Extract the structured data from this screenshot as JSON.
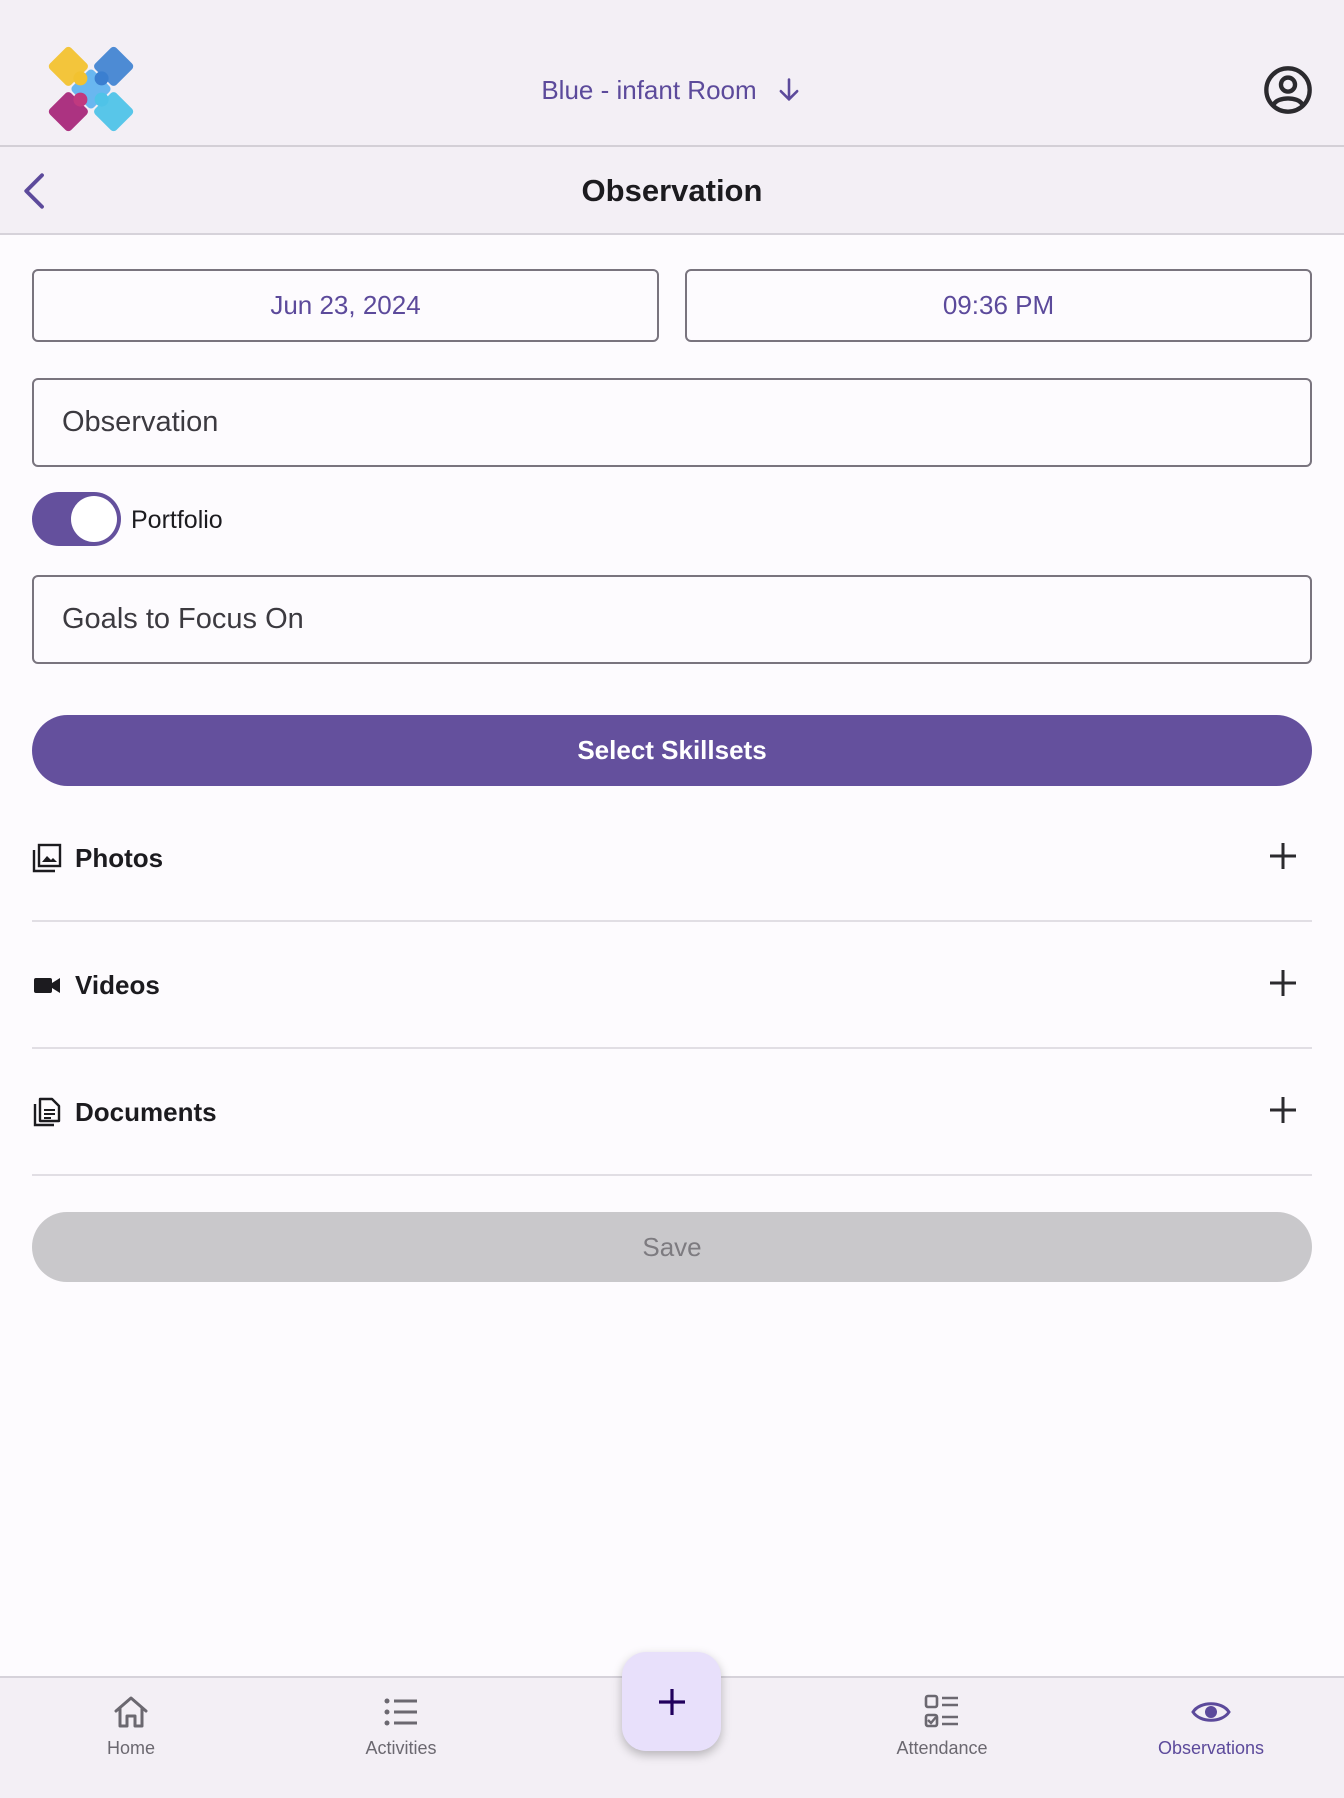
{
  "header": {
    "room_label": "Blue - infant Room",
    "logo_icon": "puzzle-logo",
    "profile_icon": "account-circle-icon"
  },
  "subheader": {
    "title": "Observation",
    "back_icon": "chevron-left-icon"
  },
  "form": {
    "date": "Jun 23, 2024",
    "time": "09:36 PM",
    "observation_placeholder": "Observation",
    "portfolio_label": "Portfolio",
    "portfolio_on": true,
    "goals_placeholder": "Goals to Focus On",
    "select_skillsets_label": "Select Skillsets",
    "save_label": "Save"
  },
  "attachments": [
    {
      "label": "Photos",
      "icon": "photo-library-icon"
    },
    {
      "label": "Videos",
      "icon": "videocam-icon"
    },
    {
      "label": "Documents",
      "icon": "document-icon"
    }
  ],
  "bottom_nav": {
    "items": [
      {
        "label": "Home",
        "icon": "home-icon"
      },
      {
        "label": "Activities",
        "icon": "list-icon"
      },
      {
        "label": "Attendance",
        "icon": "checklist-icon"
      },
      {
        "label": "Observations",
        "icon": "eye-icon",
        "active": true
      }
    ],
    "fab_icon": "plus-icon"
  },
  "colors": {
    "accent": "#64509d",
    "accent_text": "#5c4a9b",
    "disabled": "#c9c8cb",
    "fab": "#e8e0fb"
  }
}
